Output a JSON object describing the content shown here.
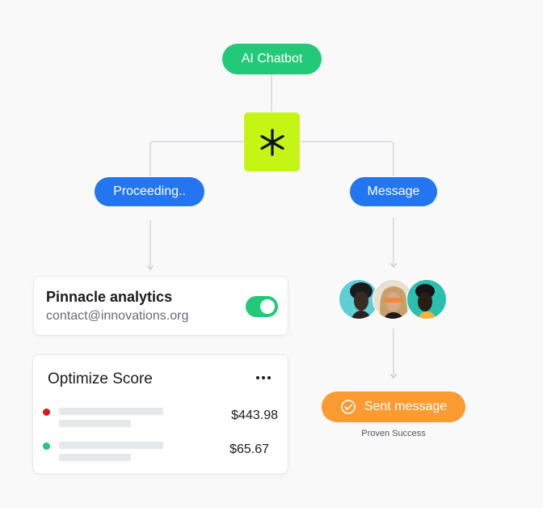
{
  "nodes": {
    "ai_chatbot": "AI Chatbot",
    "proceeding": "Proceeding..",
    "message": "Message",
    "sent_message": "Sent message",
    "proven_success": "Proven Success"
  },
  "pinnacle_card": {
    "title": "Pinnacle analytics",
    "email": "contact@innovations.org",
    "toggle_on": true
  },
  "score_card": {
    "title": "Optimize Score",
    "rows": [
      {
        "status_color": "#d91a1a",
        "amount": "$443.98"
      },
      {
        "status_color": "#22c978",
        "amount": "$65.67"
      }
    ]
  },
  "colors": {
    "green": "#22c978",
    "blue": "#2476f0",
    "orange": "#fc9b31",
    "lime": "#c4f514"
  },
  "icons": {
    "center": "asterisk-icon",
    "sent": "check-circle-icon",
    "menu": "more-horizontal-icon"
  }
}
